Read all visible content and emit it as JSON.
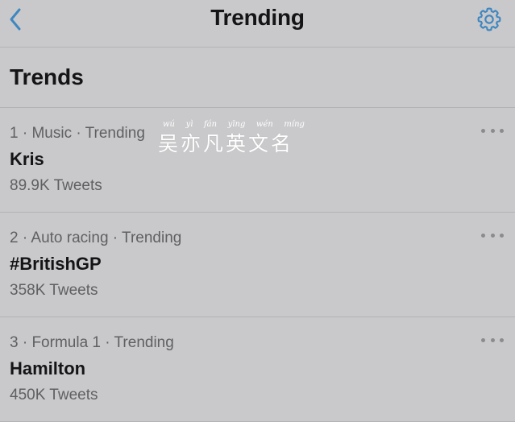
{
  "header": {
    "title": "Trending",
    "back_icon": "chevron-left-icon",
    "settings_icon": "gear-icon",
    "accent_color": "#3f87c0"
  },
  "section": {
    "title": "Trends"
  },
  "trends": [
    {
      "rank": "1",
      "meta": "1 · Music · Trending",
      "name": "Kris",
      "count": "89.9K Tweets"
    },
    {
      "rank": "2",
      "meta": "2 · Auto racing · Trending",
      "name": "#BritishGP",
      "count": "358K Tweets"
    },
    {
      "rank": "3",
      "meta": "3 · Formula 1 · Trending",
      "name": "Hamilton",
      "count": "450K Tweets"
    }
  ],
  "watermark": {
    "pinyin": [
      "wú",
      "yì",
      "fán",
      "yīng",
      "wén",
      "míng"
    ],
    "text": "吴亦凡英文名"
  }
}
